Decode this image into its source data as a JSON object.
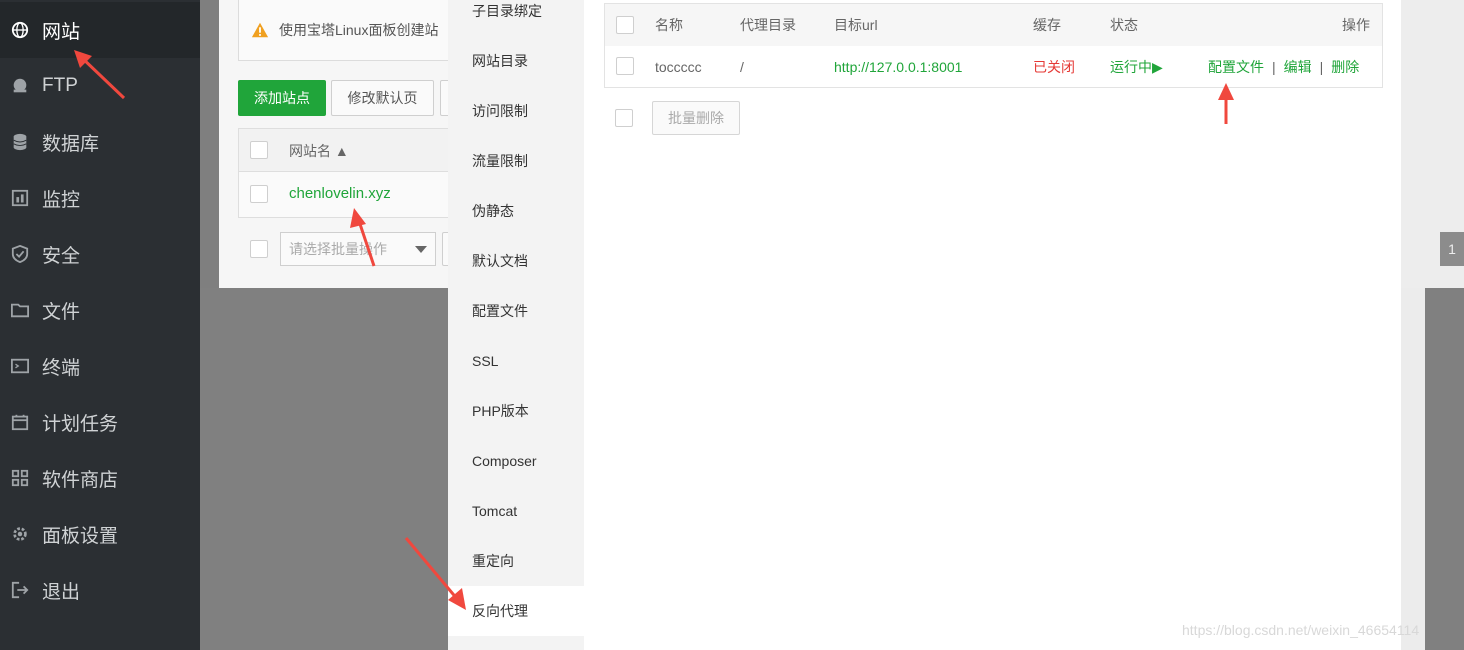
{
  "sidebar": {
    "items": [
      {
        "label": "网站",
        "icon": "globe-icon"
      },
      {
        "label": "FTP",
        "icon": "ftp-icon"
      },
      {
        "label": "数据库",
        "icon": "database-icon"
      },
      {
        "label": "监控",
        "icon": "monitor-icon"
      },
      {
        "label": "安全",
        "icon": "shield-icon"
      },
      {
        "label": "文件",
        "icon": "folder-icon"
      },
      {
        "label": "终端",
        "icon": "terminal-icon"
      },
      {
        "label": "计划任务",
        "icon": "calendar-icon"
      },
      {
        "label": "软件商店",
        "icon": "grid-icon"
      },
      {
        "label": "面板设置",
        "icon": "gear-icon"
      },
      {
        "label": "退出",
        "icon": "logout-icon"
      }
    ]
  },
  "background": {
    "notice": "使用宝塔Linux面板创建站",
    "add_site": "添加站点",
    "modify_default": "修改默认页",
    "col_site_name": "网站名 ▲",
    "site_name": "chenlovelin.xyz",
    "batch_placeholder": "请选择批量操作",
    "pager": "1"
  },
  "modal": {
    "nav": [
      "子目录绑定",
      "网站目录",
      "访问限制",
      "流量限制",
      "伪静态",
      "默认文档",
      "配置文件",
      "SSL",
      "PHP版本",
      "Composer",
      "Tomcat",
      "重定向",
      "反向代理"
    ],
    "active_nav": "反向代理",
    "proxy_table": {
      "headers": {
        "name": "名称",
        "dir": "代理目录",
        "url": "目标url",
        "cache": "缓存",
        "status": "状态",
        "ops": "操作"
      },
      "row": {
        "name": "toccccc",
        "dir": "/",
        "url": "http://127.0.0.1:8001",
        "cache": "已关闭",
        "status": "运行中▶",
        "op_config": "配置文件",
        "op_edit": "编辑",
        "op_delete": "删除",
        "sep": "|"
      }
    },
    "batch_delete": "批量删除"
  },
  "watermark": "https://blog.csdn.net/weixin_46654114",
  "colors": {
    "accent": "#20a53a",
    "danger": "#e53935",
    "sidebar": "#2b2f33",
    "annotation": "#f0483e"
  }
}
